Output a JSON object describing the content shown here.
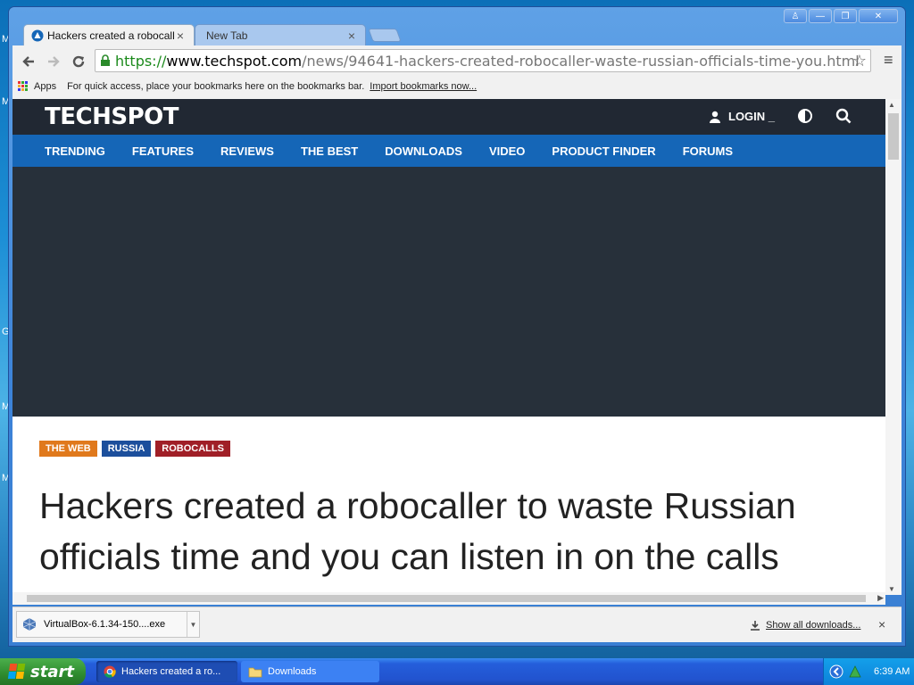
{
  "desktop": {
    "marks": [
      "M",
      "M",
      "G",
      "M",
      "M"
    ]
  },
  "browser": {
    "tabs": [
      {
        "title": "Hackers created a robocaller to waste Russian officials time",
        "close": "×"
      },
      {
        "title": "New Tab",
        "close": "×"
      }
    ],
    "window_controls": {
      "user": "♙",
      "minimize": "—",
      "maximize": "❐",
      "close": "✕"
    },
    "address": {
      "scheme": "https://",
      "host": "www.techspot.com",
      "path": "/news/94641-hackers-created-robocaller-waste-russian-officials-time-you.html"
    },
    "bookmarks": {
      "apps_label": "Apps",
      "hint": "For quick access, place your bookmarks here on the bookmarks bar.",
      "import_link": "Import bookmarks now..."
    }
  },
  "site": {
    "logo": "TECHSPOT",
    "login": "LOGIN _",
    "nav": [
      "TRENDING",
      "FEATURES",
      "REVIEWS",
      "THE BEST",
      "DOWNLOADS",
      "VIDEO",
      "PRODUCT FINDER",
      "FORUMS"
    ],
    "tags": [
      {
        "label": "THE WEB",
        "color": "#e0791c"
      },
      {
        "label": "RUSSIA",
        "color": "#1c4f9c"
      },
      {
        "label": "ROBOCALLS",
        "color": "#a01f27"
      }
    ],
    "headline": "Hackers created a robocaller to waste Russian officials time and you can listen in on the calls"
  },
  "downloads": {
    "file": "VirtualBox-6.1.34-150....exe",
    "show_all": "Show all downloads...",
    "close": "×"
  },
  "taskbar": {
    "start": "start",
    "items": [
      "Hackers created a ro...",
      "Downloads"
    ],
    "clock": "6:39 AM"
  }
}
